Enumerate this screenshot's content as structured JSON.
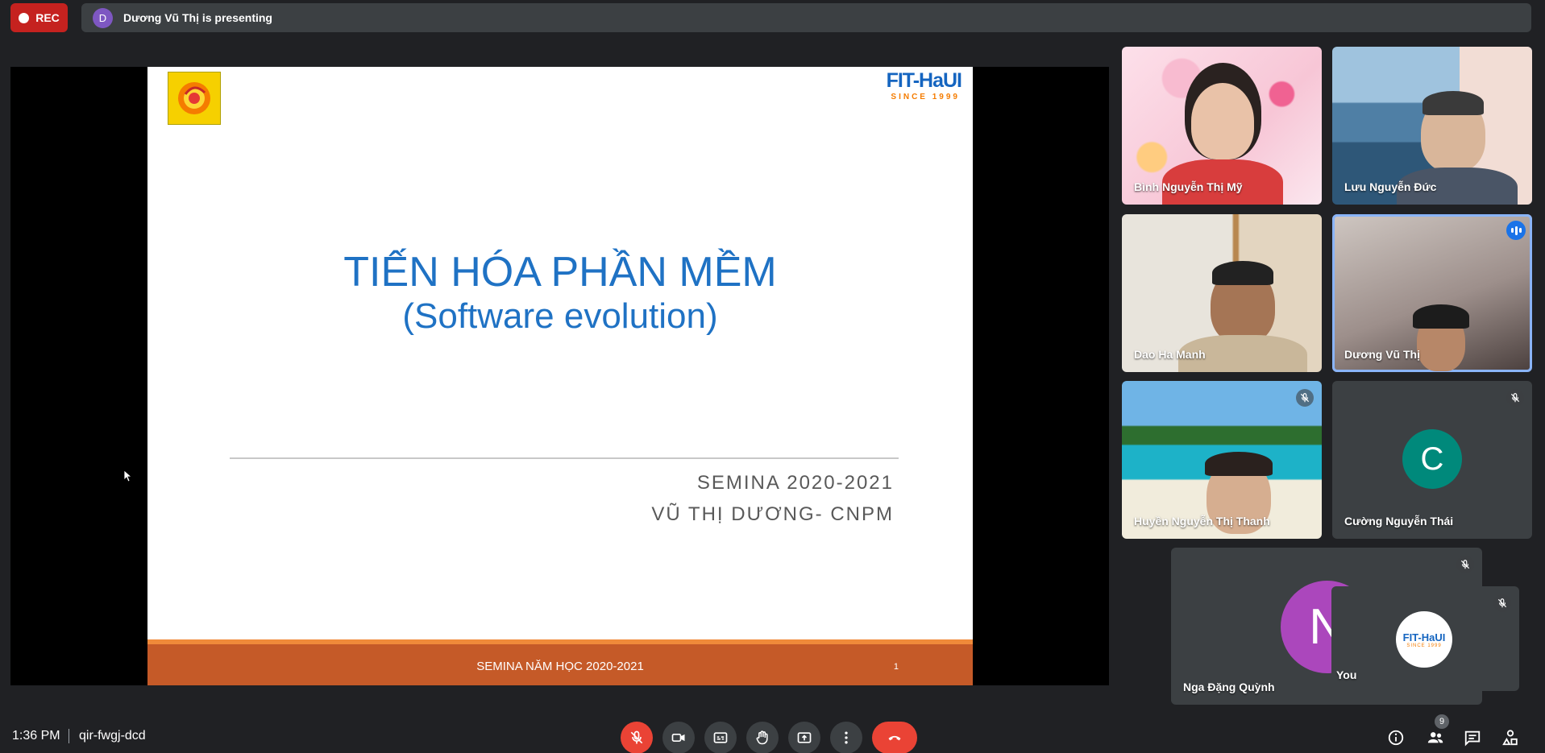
{
  "top_bar": {
    "rec_label": "REC",
    "presenter_initial": "D",
    "presenting_text": "Dương Vũ Thị is presenting"
  },
  "slide": {
    "title": "TIẾN HÓA PHẦN MỀM",
    "subtitle": "(Software evolution)",
    "line1": "SEMINA 2020-2021",
    "line2": "VŨ THỊ DƯƠNG- CNPM",
    "footer": "SEMINA NĂM HỌC 2020-2021",
    "page_number": "1",
    "logo_right_text": "FIT-HaUI",
    "logo_right_since": "SINCE 1999"
  },
  "participants": [
    {
      "name": "Bình Nguyễn Thị Mỹ"
    },
    {
      "name": "Lưu Nguyễn Đức"
    },
    {
      "name": "Dao Ha Manh"
    },
    {
      "name": "Dương Vũ Thị"
    },
    {
      "name": "Huyền Nguyễn Thị Thanh"
    },
    {
      "name": "Cường Nguyễn Thái",
      "initial": "C"
    },
    {
      "name": "Nga Đặng Quỳnh",
      "initial": "N"
    },
    {
      "name": "You",
      "logo_text": "FIT-HaUI",
      "logo_since": "SINCE 1999"
    }
  ],
  "bottom_bar": {
    "time": "1:36 PM",
    "meeting_code": "qir-fwgj-dcd",
    "participant_count": "9"
  },
  "colors": {
    "rec": "#c5221f",
    "end_call": "#ea4335",
    "active_outline": "#8ab4f8",
    "slide_title": "#1f72c4",
    "slide_footer": "#c55a28"
  }
}
